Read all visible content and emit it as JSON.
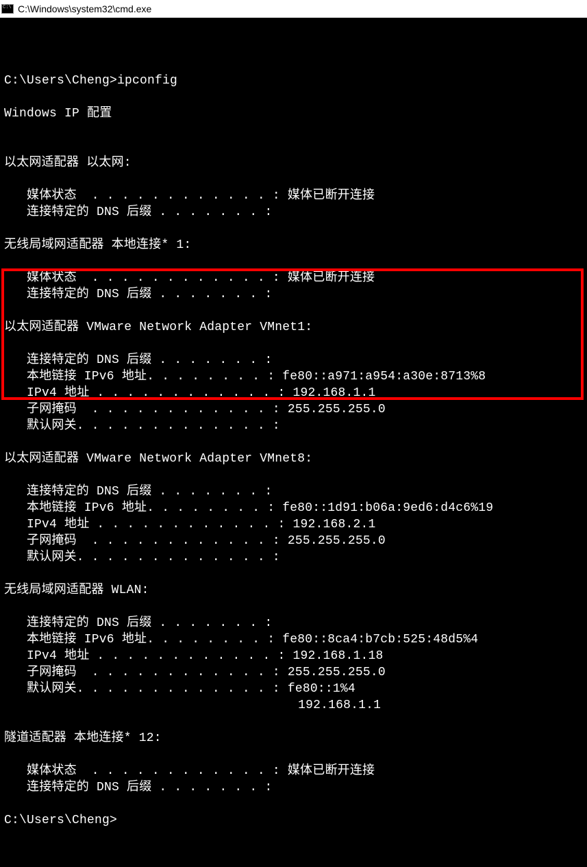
{
  "titlebar": {
    "text": "C:\\Windows\\system32\\cmd.exe"
  },
  "lines": [
    "",
    "C:\\Users\\Cheng>ipconfig",
    "",
    "Windows IP 配置",
    "",
    "",
    "以太网适配器 以太网:",
    "",
    "   媒体状态  . . . . . . . . . . . . : 媒体已断开连接",
    "   连接特定的 DNS 后缀 . . . . . . . :",
    "",
    "无线局域网适配器 本地连接* 1:",
    "",
    "   媒体状态  . . . . . . . . . . . . : 媒体已断开连接",
    "   连接特定的 DNS 后缀 . . . . . . . :",
    "",
    "以太网适配器 VMware Network Adapter VMnet1:",
    "",
    "   连接特定的 DNS 后缀 . . . . . . . :",
    "   本地链接 IPv6 地址. . . . . . . . : fe80::a971:a954:a30e:8713%8",
    "   IPv4 地址 . . . . . . . . . . . . : 192.168.1.1",
    "   子网掩码  . . . . . . . . . . . . : 255.255.255.0",
    "   默认网关. . . . . . . . . . . . . :",
    "",
    "以太网适配器 VMware Network Adapter VMnet8:",
    "",
    "   连接特定的 DNS 后缀 . . . . . . . :",
    "   本地链接 IPv6 地址. . . . . . . . : fe80::1d91:b06a:9ed6:d4c6%19",
    "   IPv4 地址 . . . . . . . . . . . . : 192.168.2.1",
    "   子网掩码  . . . . . . . . . . . . : 255.255.255.0",
    "   默认网关. . . . . . . . . . . . . :",
    "",
    "无线局域网适配器 WLAN:",
    "",
    "   连接特定的 DNS 后缀 . . . . . . . :",
    "   本地链接 IPv6 地址. . . . . . . . : fe80::8ca4:b7cb:525:48d5%4",
    "   IPv4 地址 . . . . . . . . . . . . : 192.168.1.18",
    "   子网掩码  . . . . . . . . . . . . : 255.255.255.0",
    "   默认网关. . . . . . . . . . . . . : fe80::1%4",
    "                                       192.168.1.1",
    "",
    "隧道适配器 本地连接* 12:",
    "",
    "   媒体状态  . . . . . . . . . . . . : 媒体已断开连接",
    "   连接特定的 DNS 后缀 . . . . . . . :",
    "",
    "C:\\Users\\Cheng>"
  ]
}
